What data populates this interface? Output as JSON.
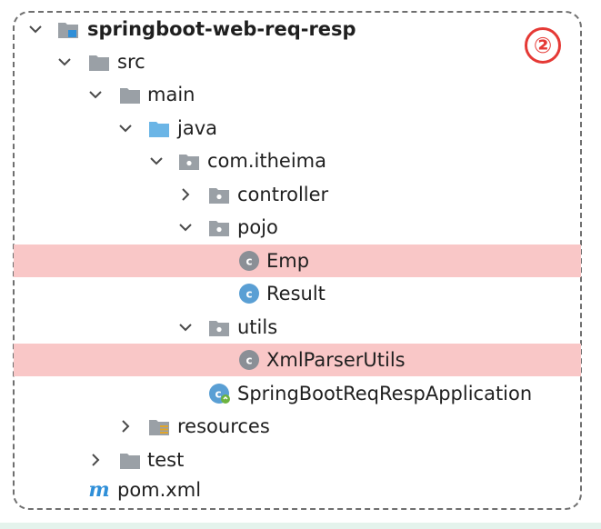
{
  "project_tree": {
    "marker_label": "②",
    "items": [
      {
        "label": "springboot-web-req-resp",
        "type": "module",
        "expanded": true
      },
      {
        "label": "src",
        "type": "folder",
        "expanded": true
      },
      {
        "label": "main",
        "type": "folder",
        "expanded": true
      },
      {
        "label": "java",
        "type": "source-folder",
        "expanded": true
      },
      {
        "label": "com.itheima",
        "type": "package",
        "expanded": true
      },
      {
        "label": "controller",
        "type": "package",
        "expanded": false
      },
      {
        "label": "pojo",
        "type": "package",
        "expanded": true
      },
      {
        "label": "Emp",
        "type": "class",
        "highlighted": true
      },
      {
        "label": "Result",
        "type": "class"
      },
      {
        "label": "utils",
        "type": "package",
        "expanded": true
      },
      {
        "label": "XmlParserUtils",
        "type": "class",
        "highlighted": true
      },
      {
        "label": "SpringBootReqRespApplication",
        "type": "spring-boot-class"
      },
      {
        "label": "resources",
        "type": "resources-folder",
        "expanded": false
      },
      {
        "label": "test",
        "type": "folder",
        "expanded": false
      },
      {
        "label": "pom.xml",
        "type": "maven-file"
      }
    ]
  },
  "colors": {
    "highlight": "#f9c7c7",
    "marker": "#e53935",
    "folder": "#9aa0a6",
    "source_folder": "#6bb5e6",
    "class_icon": "#5a9fd4"
  }
}
